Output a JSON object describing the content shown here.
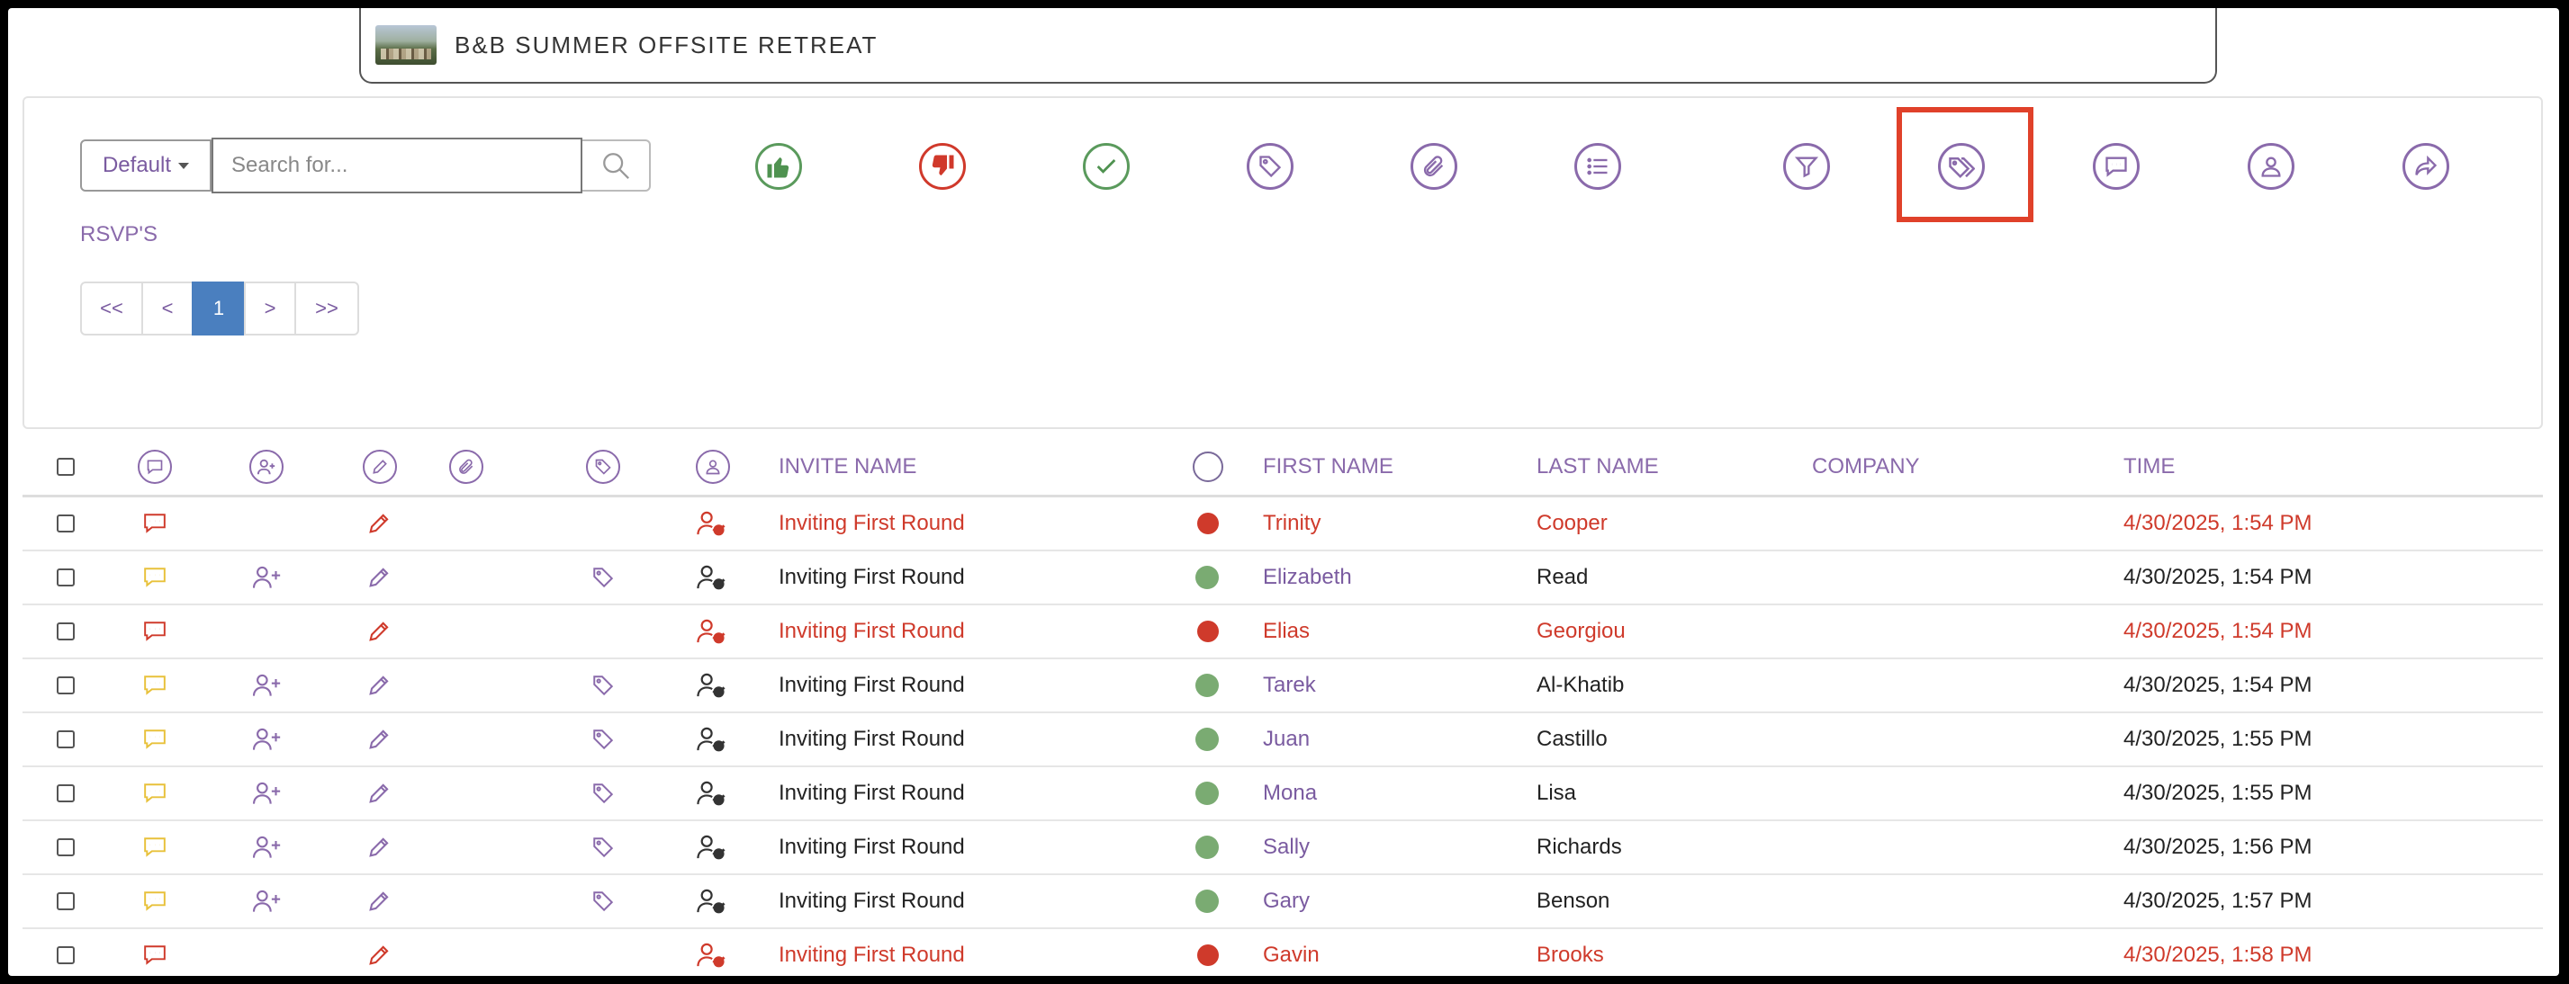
{
  "event": {
    "title": "B&B SUMMER OFFSITE RETREAT"
  },
  "toolbar": {
    "view_select": "Default",
    "search_placeholder": "Search for...",
    "section_label": "RSVP'S",
    "icons": [
      "thumbs-up-icon",
      "thumbs-down-icon",
      "check-icon",
      "tag-icon",
      "attachment-icon",
      "list-icon",
      "filter-icon",
      "tags-icon",
      "comment-icon",
      "user-icon",
      "share-icon"
    ],
    "highlighted_icon": "tags-icon"
  },
  "pagination": {
    "first": "<<",
    "prev": "<",
    "current": "1",
    "next": ">",
    "last": ">>"
  },
  "table": {
    "headers": {
      "invite_name": "INVITE NAME",
      "first_name": "FIRST NAME",
      "last_name": "LAST NAME",
      "company": "COMPANY",
      "time": "TIME"
    },
    "rows": [
      {
        "status": "declined",
        "invite": "Inviting First Round",
        "first": "Trinity",
        "last": "Cooper",
        "company": "",
        "time": "4/30/2025, 1:54 PM"
      },
      {
        "status": "accepted",
        "invite": "Inviting First Round",
        "first": "Elizabeth",
        "last": "Read",
        "company": "",
        "time": "4/30/2025, 1:54 PM"
      },
      {
        "status": "declined",
        "invite": "Inviting First Round",
        "first": "Elias",
        "last": "Georgiou",
        "company": "",
        "time": "4/30/2025, 1:54 PM"
      },
      {
        "status": "accepted",
        "invite": "Inviting First Round",
        "first": "Tarek",
        "last": "Al-Khatib",
        "company": "",
        "time": "4/30/2025, 1:54 PM"
      },
      {
        "status": "accepted",
        "invite": "Inviting First Round",
        "first": "Juan",
        "last": "Castillo",
        "company": "",
        "time": "4/30/2025, 1:55 PM"
      },
      {
        "status": "accepted",
        "invite": "Inviting First Round",
        "first": "Mona",
        "last": "Lisa",
        "company": "",
        "time": "4/30/2025, 1:55 PM"
      },
      {
        "status": "accepted",
        "invite": "Inviting First Round",
        "first": "Sally",
        "last": "Richards",
        "company": "",
        "time": "4/30/2025, 1:56 PM"
      },
      {
        "status": "accepted",
        "invite": "Inviting First Round",
        "first": "Gary",
        "last": "Benson",
        "company": "",
        "time": "4/30/2025, 1:57 PM"
      },
      {
        "status": "declined",
        "invite": "Inviting First Round",
        "first": "Gavin",
        "last": "Brooks",
        "company": "",
        "time": "4/30/2025, 1:58 PM"
      }
    ]
  },
  "colors": {
    "accent": "#8a6aab",
    "accepted": "#7aab72",
    "declined": "#cf3a2b",
    "comment_accepted": "#e8c13a",
    "highlight": "#e0412a",
    "pager_active": "#4a7fbf"
  }
}
